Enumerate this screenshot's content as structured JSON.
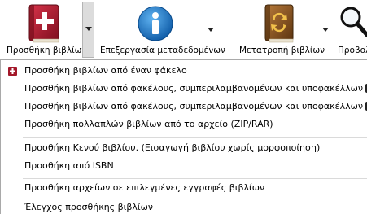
{
  "toolbar": {
    "add_books": {
      "label": "Προσθήκη βιβλίων",
      "icon": "add-book-icon"
    },
    "edit_metadata": {
      "label": "Επεξεργασία μεταδεδομένων",
      "icon": "info-icon"
    },
    "convert_books": {
      "label": "Μετατροπή βιβλίων",
      "icon": "convert-book-icon"
    },
    "view": {
      "label": "Προβολ",
      "icon": "magnifier-icon"
    }
  },
  "menu": {
    "items": [
      {
        "label": "Προσθήκη βιβλίων από έναν φάκελο"
      },
      {
        "label": "Προσθήκη βιβλίων από φακέλους, συμπεριλαμβανομένων και υποφακέλλων ("
      },
      {
        "label": "Προσθήκη βιβλίων από φακέλους, συμπεριλαμβανομένων και υποφακέλλων ("
      },
      {
        "label": "Προσθήκη πολλαπλών βιβλίων από το αρχείο (ZIP/RAR)"
      },
      {
        "label": "Προσθήκη Κενού βιβλίου. (Εισαγωγή βιβλίου χωρίς μορφοποίηση)"
      },
      {
        "label": "Προσθήκη από ISBN"
      },
      {
        "label": "Προσθήκη αρχείων σε επιλεγμένες εγγραφές βιβλίων"
      },
      {
        "label": "Έλεγχος προσθήκης βιβλίων"
      }
    ]
  },
  "colors": {
    "book_red": "#a3182a",
    "info_blue": "#1f78c8",
    "convert_brown": "#7a4a1c",
    "arrow_box": "#dcdcdc"
  }
}
